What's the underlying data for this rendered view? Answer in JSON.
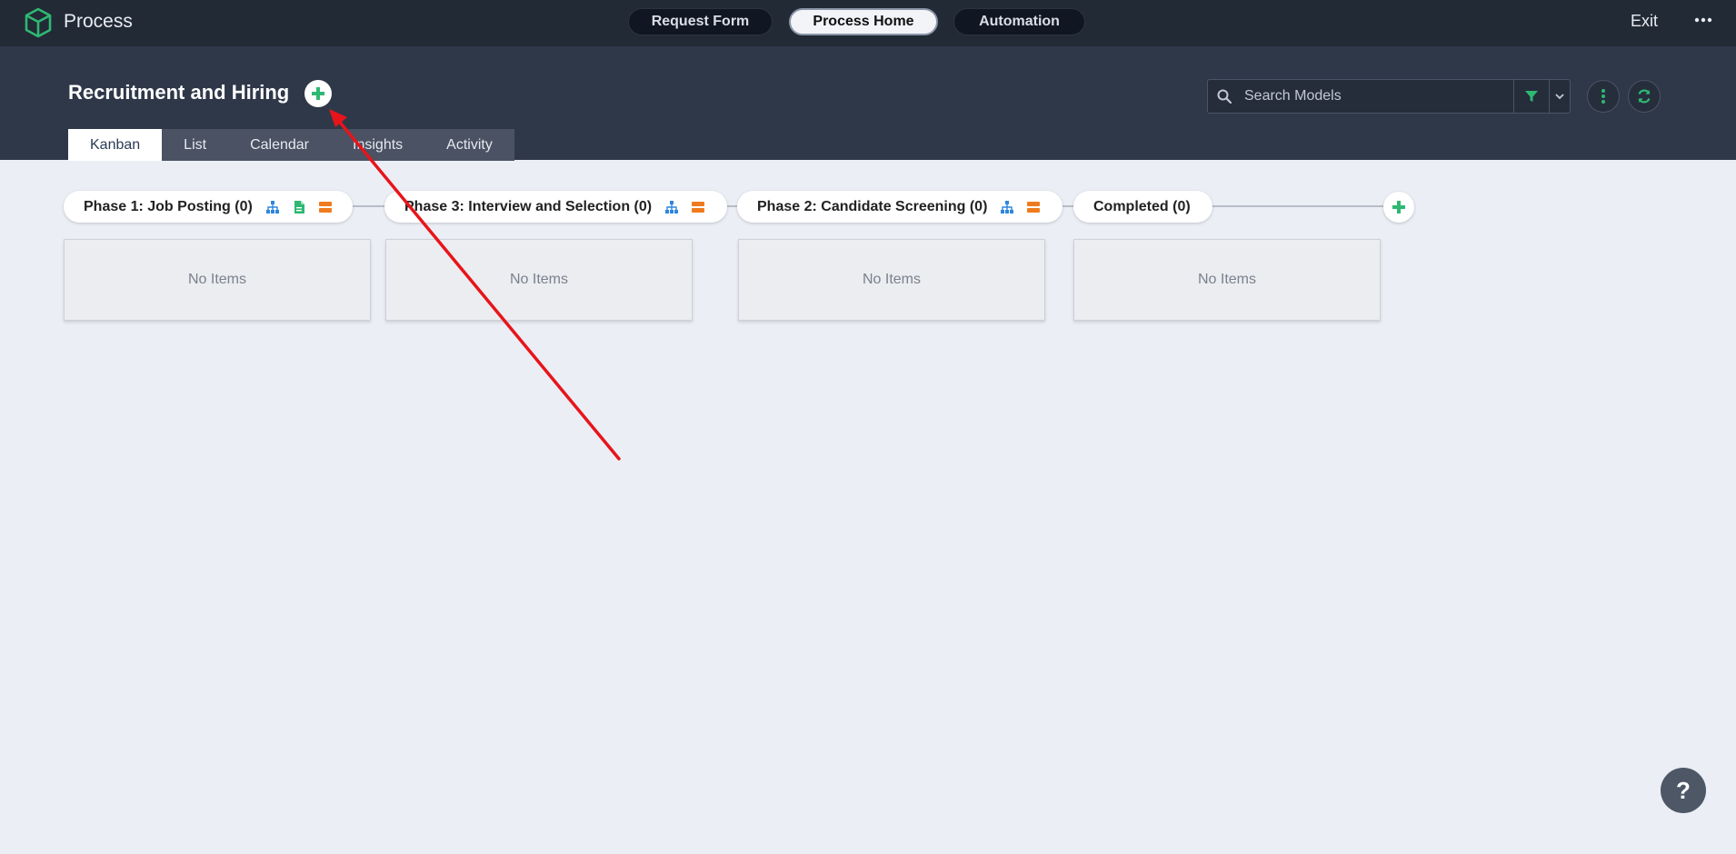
{
  "topbar": {
    "app_title": "Process",
    "nav": [
      {
        "label": "Request Form",
        "active": false
      },
      {
        "label": "Process Home",
        "active": true
      },
      {
        "label": "Automation",
        "active": false
      }
    ],
    "exit_label": "Exit",
    "more_icon": "ellipsis-icon",
    "logo_icon": "cube-icon",
    "brand_color": "#2eb872"
  },
  "header": {
    "title": "Recruitment and Hiring",
    "add_icon": "plus-icon",
    "search": {
      "placeholder": "Search Models",
      "value": ""
    },
    "tabs": [
      {
        "label": "Kanban",
        "active": true
      },
      {
        "label": "List",
        "active": false
      },
      {
        "label": "Calendar",
        "active": false
      },
      {
        "label": "Insights",
        "active": false
      },
      {
        "label": "Activity",
        "active": false
      }
    ]
  },
  "board": {
    "phases": [
      {
        "label": "Phase 1: Job Posting (0)",
        "icons": [
          "sitemap-icon",
          "document-icon",
          "layers-icon"
        ],
        "empty_text": "No Items"
      },
      {
        "label": "Phase 3: Interview and Selection (0)",
        "icons": [
          "sitemap-icon",
          "layers-icon"
        ],
        "empty_text": "No Items"
      },
      {
        "label": "Phase 2: Candidate Screening (0)",
        "icons": [
          "sitemap-icon",
          "layers-icon"
        ],
        "empty_text": "No Items"
      },
      {
        "label": "Completed (0)",
        "icons": [],
        "empty_text": "No Items"
      }
    ]
  },
  "help": {
    "label": "?"
  },
  "colors": {
    "topbar": "#222a36",
    "header": "#2f3849",
    "green": "#2eb872",
    "blue": "#2e86de",
    "orange": "#f07b1e",
    "annotation_arrow": "#e8141b"
  }
}
